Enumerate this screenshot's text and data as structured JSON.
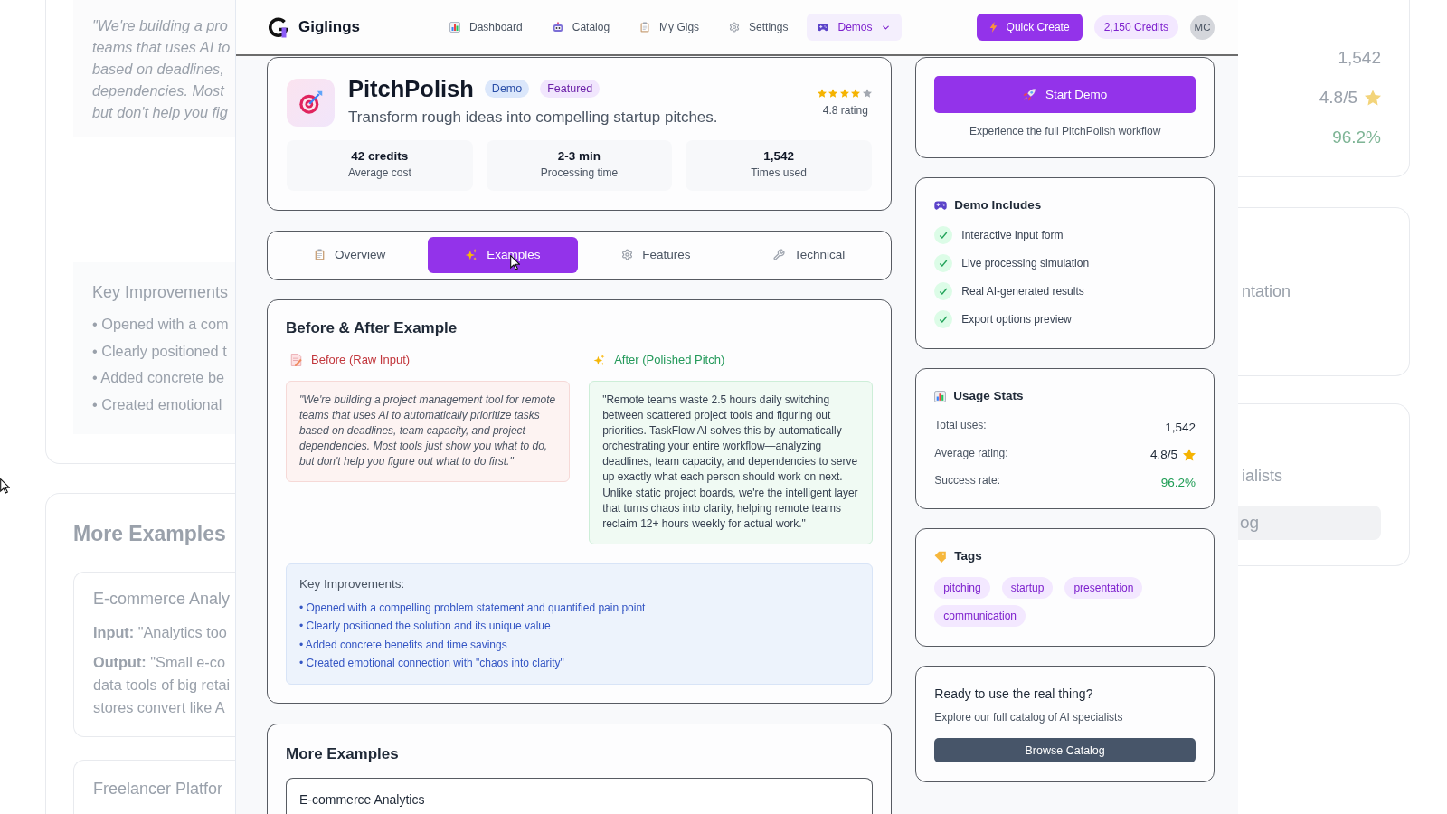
{
  "backdrop": {
    "left": {
      "quote_lines": [
        "\"We're building a pro",
        "teams that uses AI to",
        "based on deadlines,",
        "dependencies. Most",
        "but don't help you fig"
      ],
      "improvements_title": "Key Improvements",
      "improvements": [
        "• Opened with a com",
        "• Clearly positioned t",
        "• Added concrete be",
        "• Created emotional"
      ],
      "more_title": "More Examples",
      "examples": [
        {
          "title": "E-commerce Analy",
          "input_line": "**Input:** \"Analytics too",
          "output_lines": [
            "**Output:** \"Small e-co",
            "data tools of big retai",
            "stores convert like A"
          ]
        },
        {
          "title": "Freelancer Platfor"
        }
      ]
    },
    "right": {
      "stats": [
        {
          "value": "1,542",
          "kind": "plain"
        },
        {
          "value": "4.8/5",
          "kind": "rating"
        },
        {
          "value": "96.2%",
          "kind": "success"
        }
      ],
      "card_texts": [
        "ntation",
        "ialists"
      ],
      "button_text": "og"
    }
  },
  "header": {
    "brand": "Giglings",
    "nav": [
      {
        "label": "Dashboard",
        "selected": false,
        "dropdown": false
      },
      {
        "label": "Catalog",
        "selected": false,
        "dropdown": false
      },
      {
        "label": "My Gigs",
        "selected": false,
        "dropdown": false
      },
      {
        "label": "Settings",
        "selected": false,
        "dropdown": false
      },
      {
        "label": "Demos",
        "selected": true,
        "dropdown": true
      }
    ],
    "quick_create": "Quick Create",
    "credits": "2,150 Credits",
    "avatar": "MC"
  },
  "hero": {
    "title": "PitchPolish",
    "badges": [
      {
        "label": "Demo",
        "kind": "demo"
      },
      {
        "label": "Featured",
        "kind": "featured"
      }
    ],
    "stars": 4,
    "rating": "4.8 rating",
    "subtitle": "Transform rough ideas into compelling startup pitches.",
    "stats": [
      {
        "value": "42 credits",
        "label": "Average cost"
      },
      {
        "value": "2-3 min",
        "label": "Processing time"
      },
      {
        "value": "1,542",
        "label": "Times used"
      }
    ]
  },
  "tabs": [
    {
      "label": "Overview",
      "selected": false
    },
    {
      "label": "Examples",
      "selected": true
    },
    {
      "label": "Features",
      "selected": false
    },
    {
      "label": "Technical",
      "selected": false
    }
  ],
  "example": {
    "title": "Before & After Example",
    "columns": [
      {
        "kind": "before",
        "heading": "Before (Raw Input)",
        "text": "\"We're building a project management tool for remote teams that uses AI to automatically prioritize tasks based on deadlines, team capacity, and project dependencies. Most tools just show you what to do, but don't help you figure out what to do first.\""
      },
      {
        "kind": "after",
        "heading": "After (Polished Pitch)",
        "text": "\"Remote teams waste 2.5 hours daily switching between scattered project tools and figuring out priorities. TaskFlow AI solves this by automatically orchestrating your entire workflow—analyzing deadlines, team capacity, and dependencies to serve up exactly what each person should work on next. Unlike static project boards, we're the intelligent layer that turns chaos into clarity, helping remote teams reclaim 12+ hours weekly for actual work.\""
      }
    ],
    "improvements_title": "Key Improvements:",
    "improvements": [
      "• Opened with a compelling problem statement and quantified pain point",
      "• Clearly positioned the solution and its unique value",
      "• Added concrete benefits and time savings",
      "• Created emotional connection with \"chaos into clarity\""
    ]
  },
  "more_examples": {
    "title": "More Examples",
    "items": [
      {
        "title": "E-commerce Analytics"
      }
    ]
  },
  "sidebar": {
    "start": {
      "button": "Start Demo",
      "caption": "Experience the full PitchPolish workflow"
    },
    "includes": {
      "title": "Demo Includes",
      "items": [
        "Interactive input form",
        "Live processing simulation",
        "Real AI-generated results",
        "Export options preview"
      ]
    },
    "usage": {
      "title": "Usage Stats",
      "rows": [
        {
          "label": "Total uses:",
          "value": "1,542",
          "kind": "plain"
        },
        {
          "label": "Average rating:",
          "value": "4.8/5",
          "kind": "rating"
        },
        {
          "label": "Success rate:",
          "value": "96.2%",
          "kind": "success"
        }
      ]
    },
    "tags": {
      "title": "Tags",
      "items": [
        "pitching",
        "startup",
        "presentation",
        "communication"
      ]
    },
    "cta": {
      "title": "Ready to use the real thing?",
      "text": "Explore our full catalog of AI specialists",
      "button": "Browse Catalog"
    }
  }
}
